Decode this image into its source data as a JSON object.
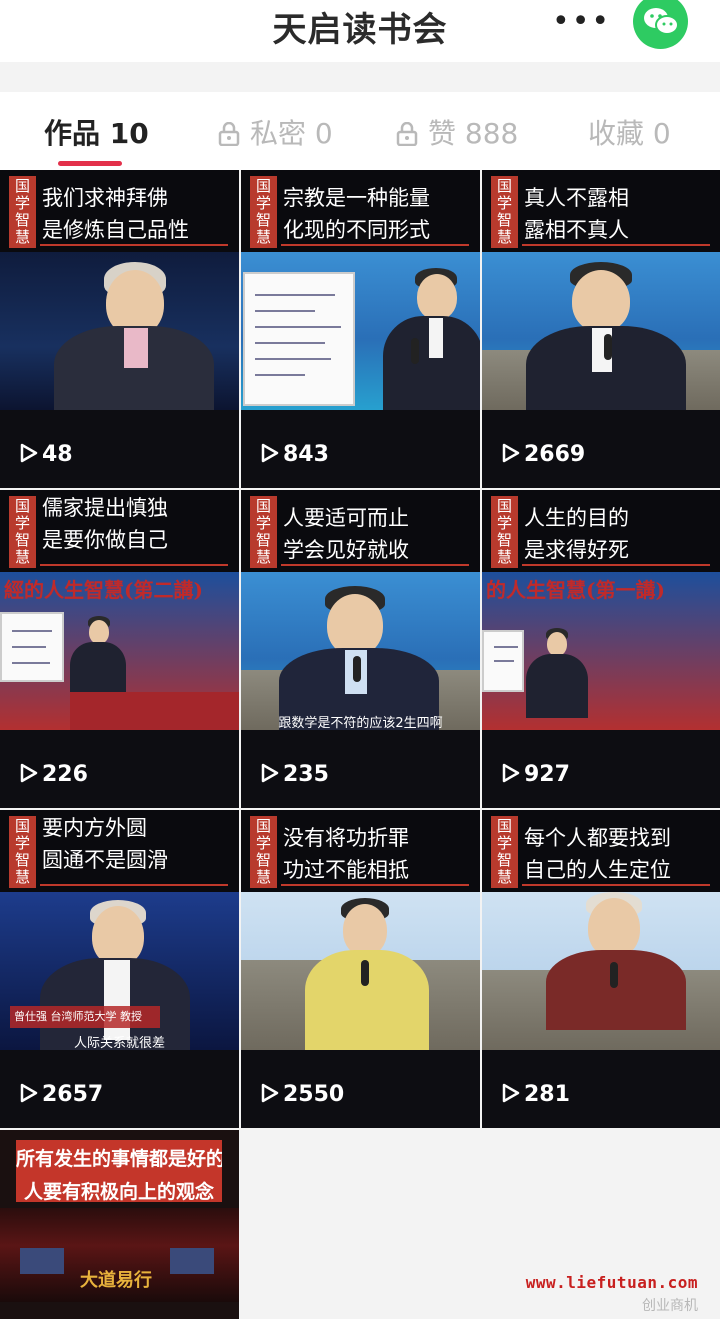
{
  "header": {
    "title": "天启读书会",
    "more_label": "•••",
    "share_icon": "wechat-icon"
  },
  "tabs": [
    {
      "label": "作品 10",
      "active": true,
      "locked": false
    },
    {
      "label": "私密 0",
      "active": false,
      "locked": true
    },
    {
      "label": "赞 888",
      "active": false,
      "locked": true
    },
    {
      "label": "收藏 0",
      "active": false,
      "locked": false
    }
  ],
  "colors": {
    "accent": "#e3304a",
    "badge": "#b83a2d",
    "wechat": "#2ecb62"
  },
  "videos": [
    {
      "badge": "国学智慧",
      "line1": "我们求神拜佛",
      "line2": "是修炼自己品性",
      "views": "48"
    },
    {
      "badge": "国学智慧",
      "line1": "宗教是一种能量",
      "line2": "化现的不同形式",
      "views": "843"
    },
    {
      "badge": "国学智慧",
      "line1": "真人不露相",
      "line2": "露相不真人",
      "views": "2669"
    },
    {
      "badge": "国学智慧",
      "line1": "儒家提出慎独",
      "line2": "是要你做自己",
      "views": "226",
      "banner": "經的人生智慧(第二講)"
    },
    {
      "badge": "国学智慧",
      "line1": "人要适可而止",
      "line2": "学会见好就收",
      "views": "235",
      "subtitle": "跟数学是不符的应该2生四啊"
    },
    {
      "badge": "国学智慧",
      "line1": "人生的目的",
      "line2": "是求得好死",
      "views": "927",
      "banner": "的人生智慧(第一講)"
    },
    {
      "badge": "国学智慧",
      "line1": "要内方外圆",
      "line2": "圆通不是圆滑",
      "views": "2657",
      "subtitle": "人际关系就很差",
      "nameplate": "曾仕强 台湾师范大学 教授"
    },
    {
      "badge": "国学智慧",
      "line1": "没有将功折罪",
      "line2": "功过不能相抵",
      "views": "2550"
    },
    {
      "badge": "国学智慧",
      "line1": "每个人都要找到",
      "line2": "自己的人生定位",
      "views": "281"
    },
    {
      "poster_line1": "所有发生的事情都是好的",
      "poster_line2": "人要有积极向上的观念",
      "stage_text": "大道易行"
    }
  ],
  "watermark": {
    "url": "www.liefutuan.com",
    "source": "创业商机"
  }
}
